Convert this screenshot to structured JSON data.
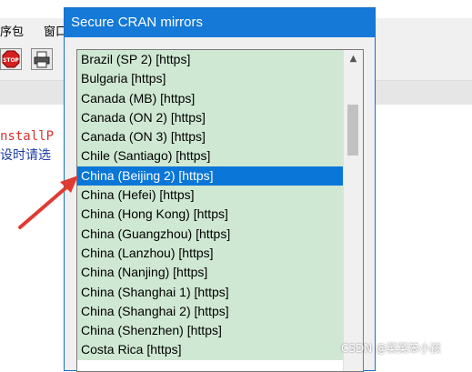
{
  "background_window": {
    "menu": [
      "序包",
      "窗口"
    ],
    "console_lines": [
      "nstallP",
      "设时请选"
    ]
  },
  "dialog": {
    "title": "Secure CRAN mirrors",
    "mirrors": [
      "Brazil (SP 2) [https]",
      "Bulgaria [https]",
      "Canada (MB) [https]",
      "Canada (ON 2) [https]",
      "Canada (ON 3) [https]",
      "Chile (Santiago) [https]",
      "China (Beijing 2) [https]",
      "China (Hefei) [https]",
      "China (Hong Kong) [https]",
      "China (Guangzhou) [https]",
      "China (Lanzhou) [https]",
      "China (Nanjing) [https]",
      "China (Shanghai 1) [https]",
      "China (Shanghai 2) [https]",
      "China (Shenzhen) [https]",
      "Costa Rica [https]"
    ],
    "selected": "China (Beijing 2) [https]"
  },
  "watermark": "CSDN @菜菜笨小孩",
  "icons": {
    "stop": "stop-icon",
    "print": "print-icon",
    "scroll_up": "chevron-up-icon",
    "arrow": "red-arrow-annotation"
  },
  "colors": {
    "titlebar": "#1479d7",
    "row_bg": "#cfe8d3",
    "selection": "#0a76d8",
    "arrow": "#e03a33"
  }
}
